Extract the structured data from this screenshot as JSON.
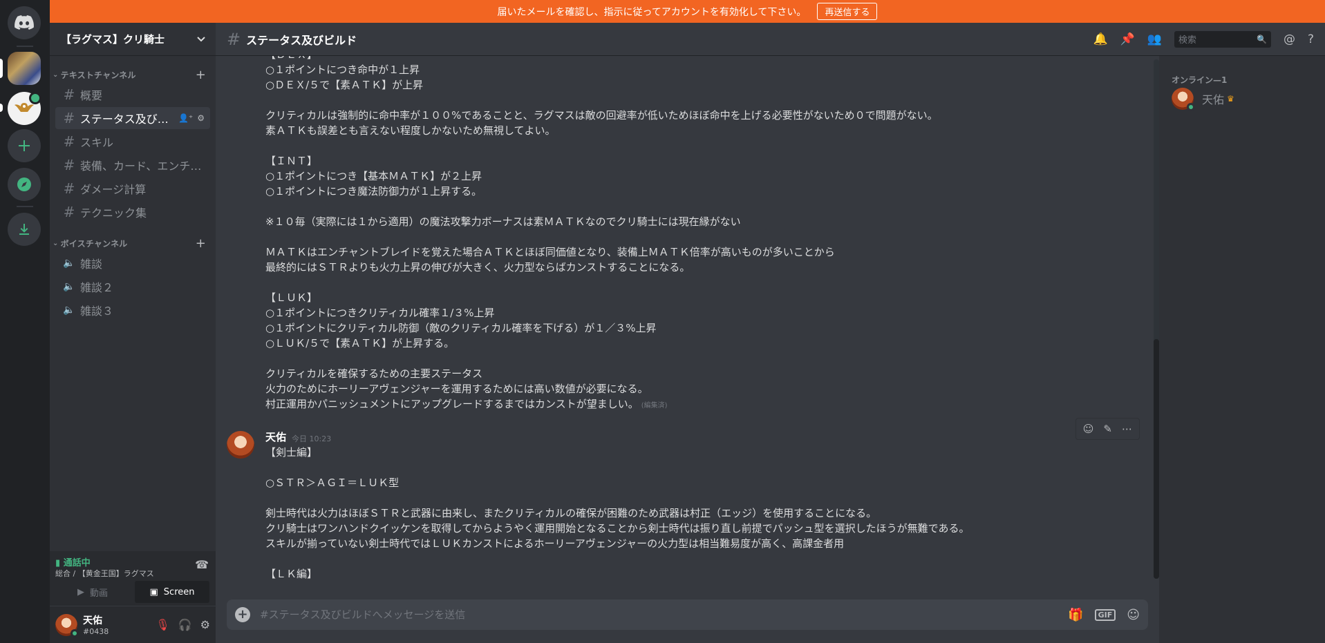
{
  "notice": {
    "text": "届いたメールを確認し、指示に従ってアカウントを有効化して下さい。",
    "button": "再送信する"
  },
  "guild": {
    "name": "【ラグマス】クリ騎士"
  },
  "categories": {
    "text": "テキストチャンネル",
    "voice": "ボイスチャンネル"
  },
  "text_channels": [
    "概要",
    "ステータス及びビ…",
    "スキル",
    "装備、カード、エンチ…",
    "ダメージ計算",
    "テクニック集"
  ],
  "voice_channels": [
    "雑談",
    "雑談２",
    "雑談３"
  ],
  "voice": {
    "status": "通話中",
    "location": "総合 / 【黄金王国】ラグマス",
    "video_label": "動画",
    "screen_label": "Screen"
  },
  "user": {
    "name": "天佑",
    "tag": "#0438"
  },
  "chat": {
    "channel": "ステータス及びビルド",
    "search_placeholder": "検索",
    "composer_placeholder": "#ステータス及びビルドへメッセージを送信"
  },
  "messages": {
    "prev_lines": [
      "【ＤＥＸ】",
      "○１ポイントにつき命中が１上昇",
      "○ＤＥＸ/５で【素ＡＴＫ】が上昇",
      "",
      "クリティカルは強制的に命中率が１００%であることと、ラグマスは敵の回避率が低いためほぼ命中を上げる必要性がないため０で問題がない。",
      "素ＡＴＫも誤差とも言えない程度しかないため無視してよい。",
      "",
      "【ＩＮＴ】",
      "○１ポイントにつき【基本ＭＡＴＫ】が２上昇",
      "○１ポイントにつき魔法防御力が１上昇する。",
      "",
      "※１０毎（実際には１から適用）の魔法攻撃力ボーナスは素ＭＡＴＫなのでクリ騎士には現在縁がない",
      "",
      "ＭＡＴＫはエンチャントブレイドを覚えた場合ＡＴＫとほぼ同価値となり、装備上ＭＡＴＫ倍率が高いものが多いことから",
      "最終的にはＳＴＲよりも火力上昇の伸びが大きく、火力型ならばカンストすることになる。",
      "",
      "【ＬＵＫ】",
      "○１ポイントにつきクリティカル確率１/３%上昇",
      "○１ポイントにクリティカル防御（敵のクリティカル確率を下げる）が１／３%上昇",
      "○ＬＵＫ/５で【素ＡＴＫ】が上昇する。",
      "",
      "クリティカルを確保するための主要ステータス",
      "火力のためにホーリーアヴェンジャーを運用するためには高い数値が必要になる。",
      "村正運用かパニッシュメントにアップグレードするまではカンストが望ましい。"
    ],
    "edited": "(編集済)",
    "author": "天佑",
    "timestamp": "今日 10:23",
    "lines": [
      "【剣士編】",
      "",
      "○ＳＴＲ＞ＡＧＩ＝ＬＵＫ型",
      "",
      "剣士時代は火力はほぼＳＴＲと武器に由来し、またクリティカルの確保が困難のため武器は村正（エッジ）を使用することになる。",
      "クリ騎士はワンハンドクイッケンを取得してからようやく運用開始となることから剣士時代は振り直し前提でパッシュ型を選択したほうが無難である。",
      "スキルが揃っていない剣士時代ではＬＵＫカンストによるホーリーアヴェンジャーの火力型は相当難易度が高く、高課金者用",
      "",
      "【ＬＫ編】"
    ]
  },
  "members": {
    "heading": "オンライン—1",
    "list": [
      {
        "name": "天佑"
      }
    ]
  }
}
